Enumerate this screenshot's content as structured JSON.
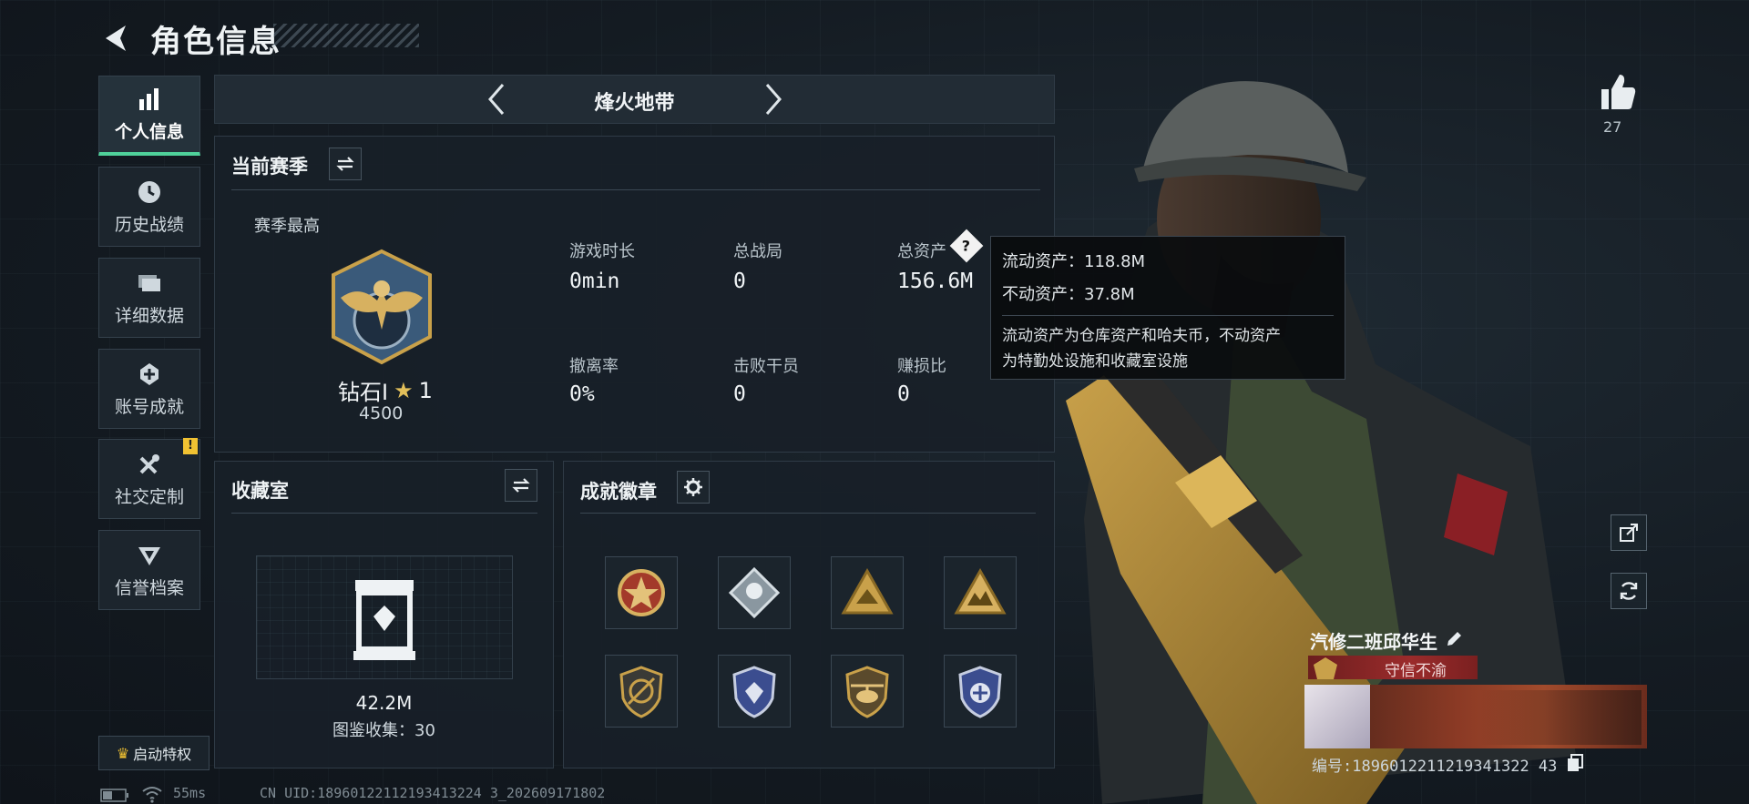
{
  "header": {
    "title": "角色信息"
  },
  "sidebar": {
    "items": [
      {
        "label": "个人信息",
        "icon": "bar-chart-icon"
      },
      {
        "label": "历史战绩",
        "icon": "clock-icon"
      },
      {
        "label": "详细数据",
        "icon": "folder-icon"
      },
      {
        "label": "账号成就",
        "icon": "achievement-icon"
      },
      {
        "label": "社交定制",
        "icon": "tools-icon",
        "alert": "!"
      },
      {
        "label": "信誉档案",
        "icon": "emblem-icon"
      }
    ],
    "perk_button": "启动特权"
  },
  "mode_bar": {
    "name": "烽火地带"
  },
  "season_panel": {
    "title": "当前赛季",
    "best_label": "赛季最高",
    "rank_name": "钻石Ⅰ",
    "rank_stars": "1",
    "rank_points": "4500",
    "stats": [
      {
        "label": "游戏时长",
        "value": "0min"
      },
      {
        "label": "总战局",
        "value": "0"
      },
      {
        "label": "总资产",
        "value": "156.6M"
      },
      {
        "label": "撤离率",
        "value": "0%"
      },
      {
        "label": "击败干员",
        "value": "0"
      },
      {
        "label": "赚损比",
        "value": "0"
      }
    ]
  },
  "tooltip": {
    "liquid": "流动资产：118.8M",
    "fixed": "不动资产：37.8M",
    "desc_line1": "流动资产为仓库资产和哈夫币，不动资产",
    "desc_line2": "为特勤处设施和收藏室设施"
  },
  "collection_panel": {
    "title": "收藏室",
    "value": "42.2M",
    "codex": "图鉴收集：30"
  },
  "badge_panel": {
    "title": "成就徽章",
    "badges": [
      "star-medal-icon",
      "rose-diamond-icon",
      "gold-triangle-icon",
      "gold-triangle-icon-2",
      "shield-slash-icon",
      "blue-shield-icon",
      "helicopter-shield-icon",
      "blue-badge-icon"
    ]
  },
  "right": {
    "like_count": "27",
    "player_name": "汽修二班邱华生",
    "player_title": "守信不渝",
    "player_id": "编号:1896012211219341322 43"
  },
  "footer": {
    "ping": "55ms",
    "uid": "CN UID:18960122112193413224 3_202609171802"
  },
  "colors": {
    "accent": "#4fd19a",
    "alert": "#f1c232",
    "banner": "#9b2b2b"
  }
}
